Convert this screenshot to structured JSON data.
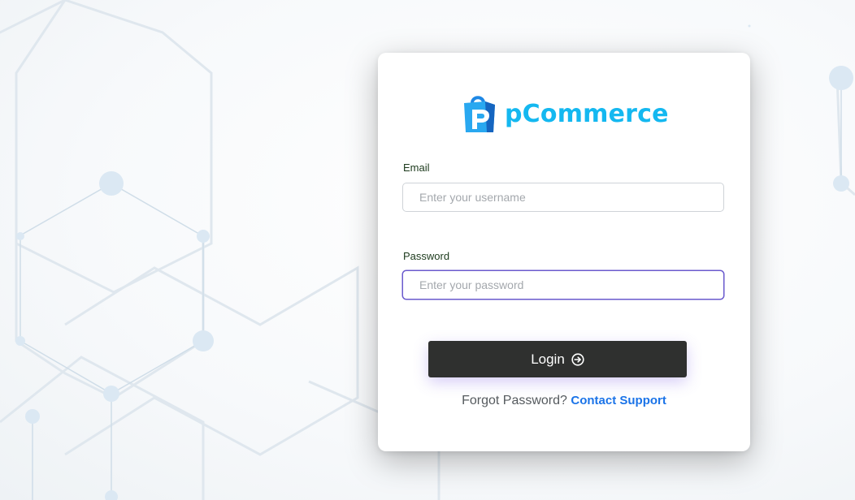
{
  "brand": {
    "name": "pCommerce",
    "color": "#14b8f0",
    "bag_color": "#1565c0"
  },
  "form": {
    "email_label": "Email",
    "email_placeholder": "Enter your username",
    "email_value": "",
    "password_label": "Password",
    "password_placeholder": "Enter your password",
    "password_value": "",
    "login_label": "Login",
    "login_icon": "arrow-right-circle-icon"
  },
  "footer": {
    "forgot_text": "Forgot Password?",
    "support_link": "Contact Support"
  },
  "colors": {
    "button_bg": "#2f302f",
    "link": "#1a73e8",
    "focus_border": "#6a5acd"
  }
}
